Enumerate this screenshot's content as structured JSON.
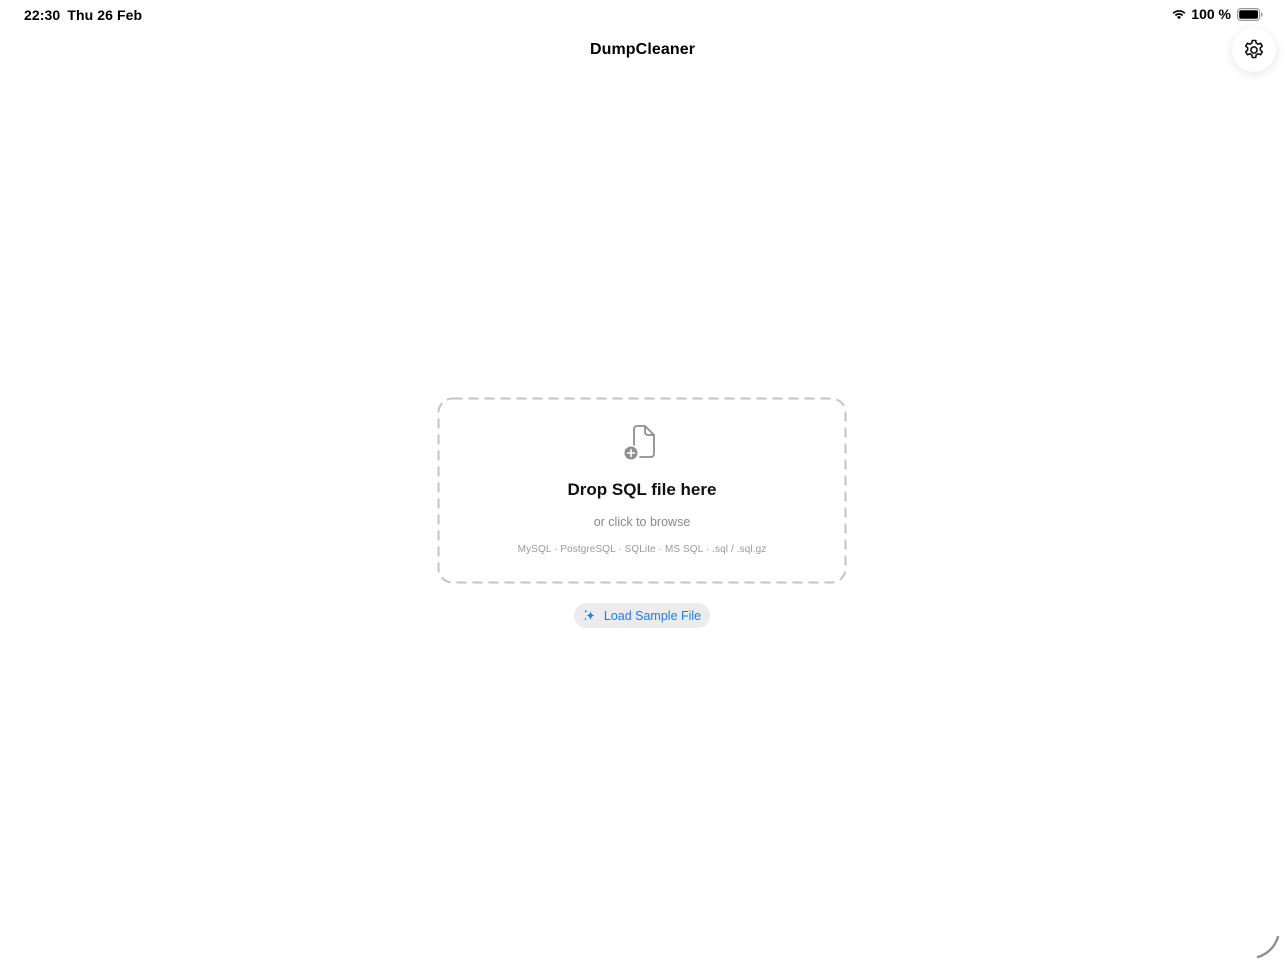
{
  "status_bar": {
    "time": "22:30",
    "date": "Thu 26 Feb",
    "battery": "100 %"
  },
  "nav": {
    "title": "DumpCleaner"
  },
  "drop_zone": {
    "title": "Drop SQL file here",
    "subtitle": "or click to browse",
    "formats": "MySQL · PostgreSQL · SQLite · MS SQL · .sql / .sql.gz",
    "icon": "doc-badge-plus-icon"
  },
  "sample_button": {
    "label": "Load Sample File",
    "icon": "sparkles-icon"
  },
  "colors": {
    "accent": "#1a7de6",
    "secondary_text": "#8a8a8e",
    "dash_border": "#c4c4c6",
    "button_bg": "#ececee"
  }
}
